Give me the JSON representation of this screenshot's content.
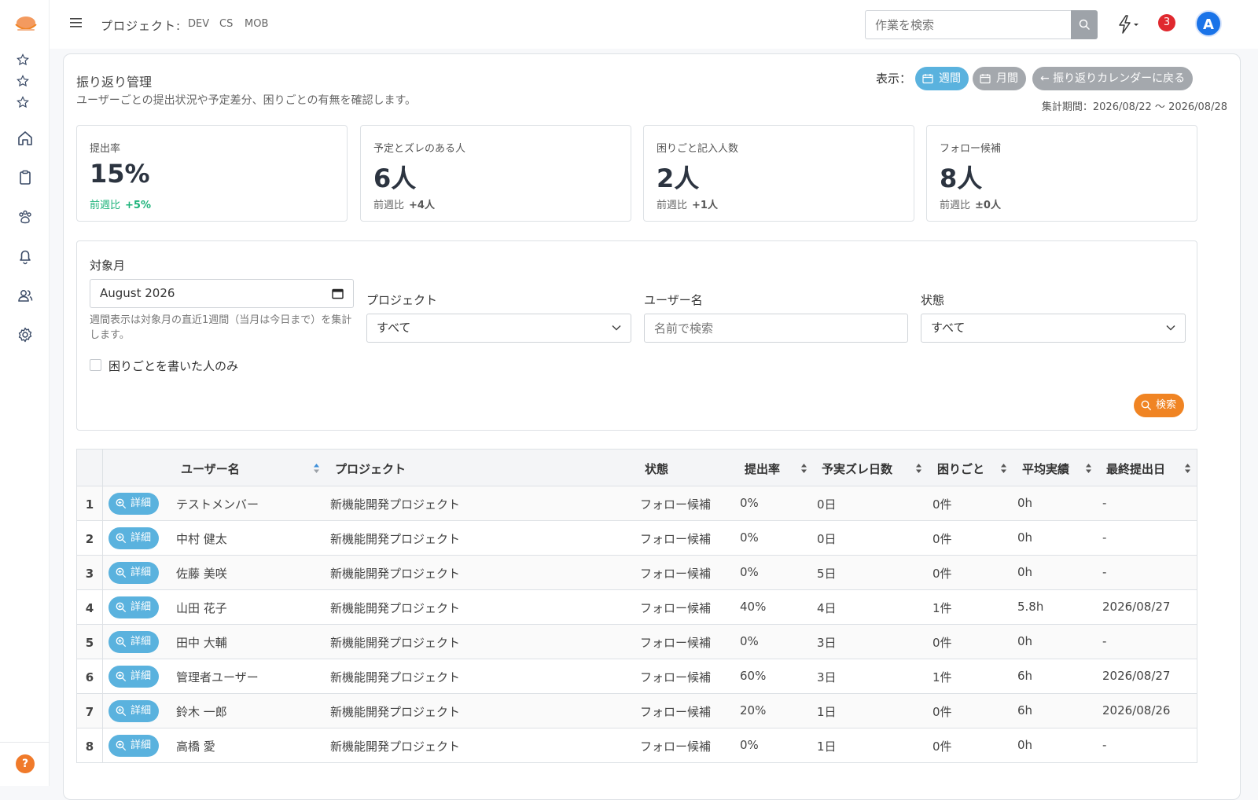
{
  "topbar": {
    "project_label": "プロジェクト:",
    "project_tags": [
      "DEV",
      "CS",
      "MOB"
    ],
    "search_placeholder": "作業を検索",
    "notification_count": "3",
    "avatar_initial": "A"
  },
  "sidebar": {
    "help_label": "?"
  },
  "page": {
    "title": "振り返り管理",
    "subtitle": "ユーザーごとの提出状況や予定差分、困りごとの有無を確認します。",
    "view_label": "表示：",
    "view_week": "週間",
    "view_month": "月間",
    "back_button": "← 振り返りカレンダーに戻る",
    "period": "集計期間：2026/08/22 〜 2026/08/28"
  },
  "kpis": [
    {
      "label": "提出率",
      "value": "15%",
      "delta_label": "前週比",
      "delta": "+5%"
    },
    {
      "label": "予定とズレのある人",
      "value": "6人",
      "delta_label": "前週比",
      "delta": "+4人"
    },
    {
      "label": "困りごと記入人数",
      "value": "2人",
      "delta_label": "前週比",
      "delta": "+1人"
    },
    {
      "label": "フォロー候補",
      "value": "8人",
      "delta_label": "前週比",
      "delta": "±0人"
    }
  ],
  "filters": {
    "month_label": "対象月",
    "month_value": "August 2026",
    "month_help": "週間表示は対象月の直近1週間（当月は今日まで）を集計します。",
    "project_label": "プロジェクト",
    "project_value": "すべて",
    "user_label": "ユーザー名",
    "user_placeholder": "名前で検索",
    "status_label": "状態",
    "status_value": "すべて",
    "checkbox_label": "困りごとを書いた人のみ",
    "search_button": "検索"
  },
  "table": {
    "headers": {
      "user": "ユーザー名",
      "project": "プロジェクト",
      "status": "状態",
      "rate": "提出率",
      "diff": "予実ズレ日数",
      "issues": "困りごと",
      "avg": "平均実績",
      "last": "最終提出日"
    },
    "detail_label": "詳細",
    "rows": [
      {
        "idx": "1",
        "user": "テストメンバー",
        "project": "新機能開発プロジェクト",
        "status": "フォロー候補",
        "rate": "0%",
        "diff": "0日",
        "issues": "0件",
        "avg": "0h",
        "last": "-"
      },
      {
        "idx": "2",
        "user": "中村 健太",
        "project": "新機能開発プロジェクト",
        "status": "フォロー候補",
        "rate": "0%",
        "diff": "0日",
        "issues": "0件",
        "avg": "0h",
        "last": "-"
      },
      {
        "idx": "3",
        "user": "佐藤 美咲",
        "project": "新機能開発プロジェクト",
        "status": "フォロー候補",
        "rate": "0%",
        "diff": "5日",
        "issues": "0件",
        "avg": "0h",
        "last": "-"
      },
      {
        "idx": "4",
        "user": "山田 花子",
        "project": "新機能開発プロジェクト",
        "status": "フォロー候補",
        "rate": "40%",
        "diff": "4日",
        "issues": "1件",
        "avg": "5.8h",
        "last": "2026/08/27"
      },
      {
        "idx": "5",
        "user": "田中 大輔",
        "project": "新機能開発プロジェクト",
        "status": "フォロー候補",
        "rate": "0%",
        "diff": "3日",
        "issues": "0件",
        "avg": "0h",
        "last": "-"
      },
      {
        "idx": "6",
        "user": "管理者ユーザー",
        "project": "新機能開発プロジェクト",
        "status": "フォロー候補",
        "rate": "60%",
        "diff": "3日",
        "issues": "1件",
        "avg": "6h",
        "last": "2026/08/27"
      },
      {
        "idx": "7",
        "user": "鈴木 一郎",
        "project": "新機能開発プロジェクト",
        "status": "フォロー候補",
        "rate": "20%",
        "diff": "1日",
        "issues": "0件",
        "avg": "6h",
        "last": "2026/08/26"
      },
      {
        "idx": "8",
        "user": "高橋 愛",
        "project": "新機能開発プロジェクト",
        "status": "フォロー候補",
        "rate": "0%",
        "diff": "1日",
        "issues": "0件",
        "avg": "0h",
        "last": "-"
      }
    ]
  },
  "colors": {
    "accent_blue": "#5ab2de",
    "accent_orange": "#f08423",
    "badge_red": "#e0282e",
    "avatar_blue": "#1a73e8",
    "positive_green": "#1db37a"
  }
}
